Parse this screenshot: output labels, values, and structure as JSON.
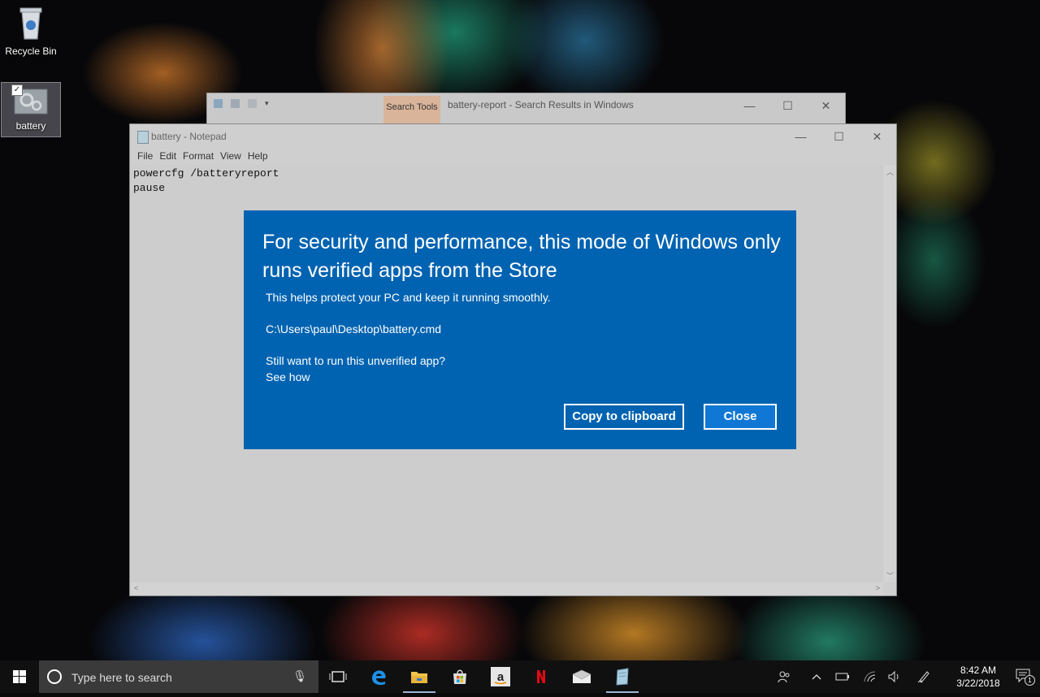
{
  "desktop": {
    "icons": [
      {
        "label": "Recycle Bin",
        "icon": "recycle-bin-icon"
      },
      {
        "label": "battery",
        "icon": "batch-file-icon"
      }
    ]
  },
  "explorer": {
    "title": "battery-report - Search Results in Windows",
    "contextual_tab": "Search Tools",
    "controls": {
      "minimize": "—",
      "maximize": "☐",
      "close": "✕"
    }
  },
  "notepad": {
    "title": "battery - Notepad",
    "menu": [
      "File",
      "Edit",
      "Format",
      "View",
      "Help"
    ],
    "content": "powercfg /batteryreport\npause",
    "controls": {
      "minimize": "—",
      "maximize": "☐",
      "close": "✕"
    }
  },
  "dialog": {
    "heading": "For security and performance, this mode of Windows only runs verified apps from the Store",
    "subtitle": "This helps protect your PC and keep it running smoothly.",
    "path": "C:\\Users\\paul\\Desktop\\battery.cmd",
    "question": "Still want to run this unverified app?",
    "link": "See how",
    "copy_button": "Copy to clipboard",
    "close_button": "Close",
    "accent": "#0063b1"
  },
  "taskbar": {
    "search_placeholder": "Type here to search",
    "apps": [
      "task-view-icon",
      "edge-icon",
      "file-explorer-icon",
      "store-icon",
      "amazon-icon",
      "netflix-icon",
      "mail-icon",
      "notepad-icon"
    ],
    "time": "8:42 AM",
    "date": "3/22/2018",
    "notification_count": "1"
  }
}
